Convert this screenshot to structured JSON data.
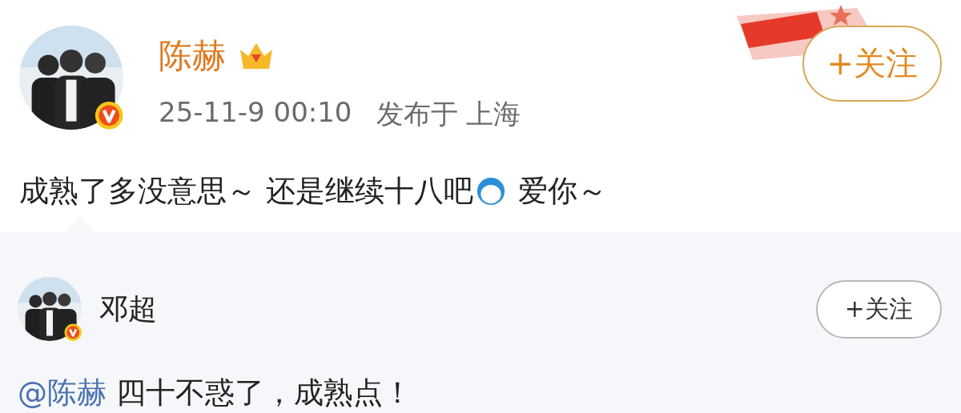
{
  "post": {
    "author": {
      "name": "陈赫",
      "verified": true,
      "vip_crown": true
    },
    "time": "25-11-9 00:10",
    "location": "发布于 上海",
    "follow_button": "+关注",
    "content": [
      {
        "kind": "text",
        "text": "成熟了多没意思～ 还是继续十八吧"
      },
      {
        "kind": "emoji"
      },
      {
        "kind": "text",
        "text": " 爱你～"
      }
    ]
  },
  "repost": {
    "author": {
      "name": "邓超",
      "verified": true
    },
    "follow_button": "+关注",
    "content": [
      {
        "kind": "mention",
        "text": "@陈赫"
      },
      {
        "kind": "text",
        "text": " 四十不惑了，成熟点！"
      }
    ]
  }
}
